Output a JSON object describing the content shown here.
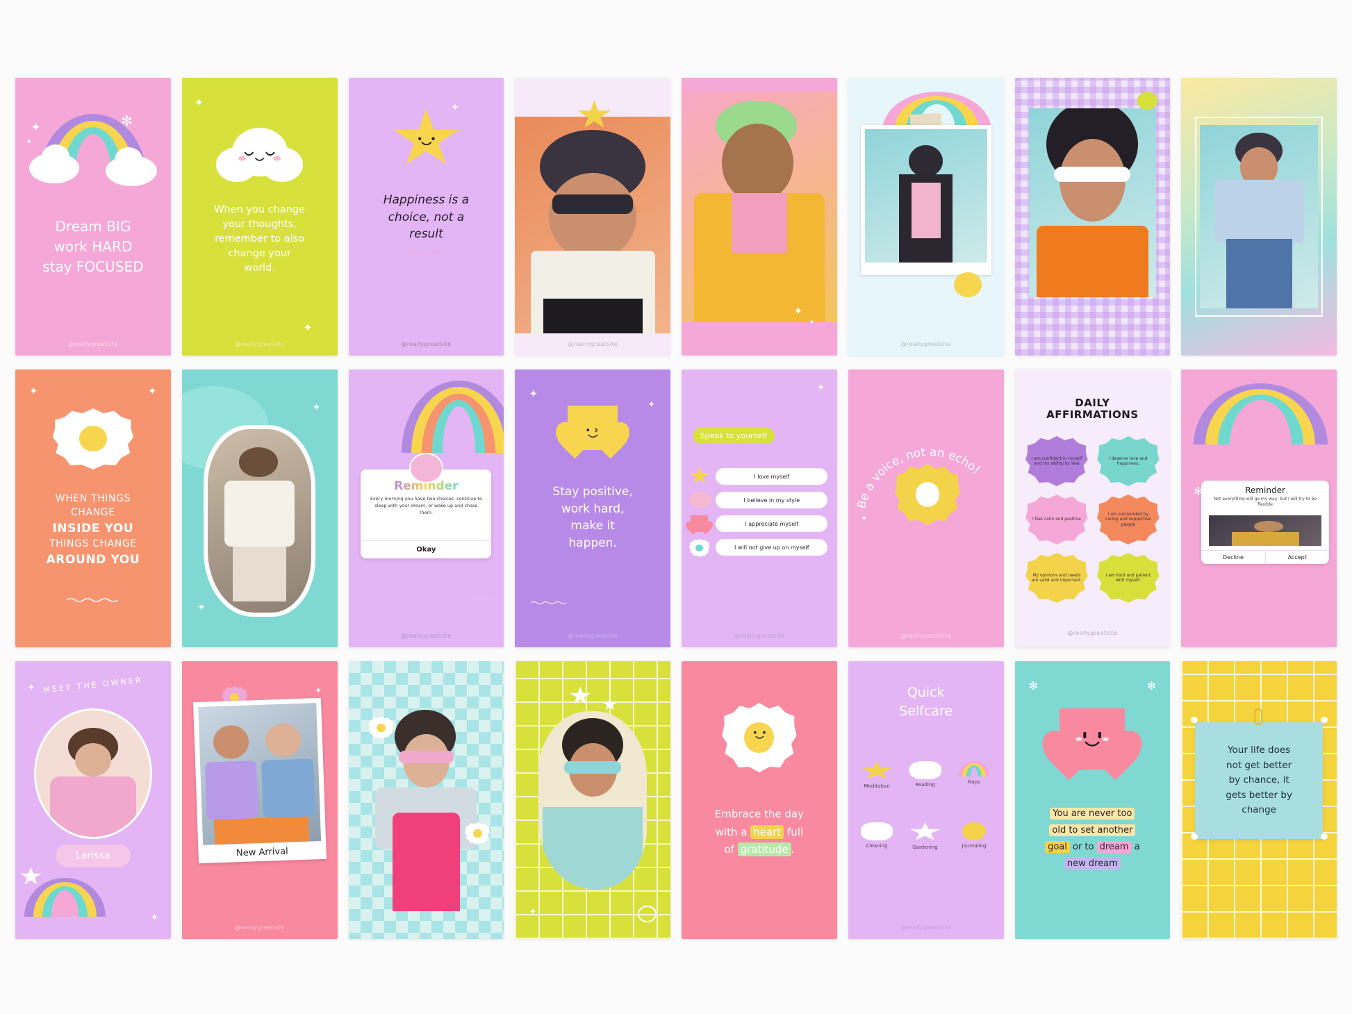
{
  "canvas": {
    "background": "#fbfbfb",
    "columns": 8,
    "rows": 3
  },
  "handle": "@reallygreatsite",
  "cards": [
    {
      "id": "dream-big",
      "row": 1,
      "col": 1,
      "type": "quote-rainbow",
      "background": "#f5a8d8",
      "text_color": "#ffffff",
      "quote_lines": [
        "Dream BIG",
        "work HARD",
        "stay FOCUSED"
      ],
      "handle": "@reallygreatsite",
      "motifs": [
        "rainbow",
        "clouds",
        "sparkles"
      ],
      "rainbow_colors": [
        "#b18ae0",
        "#f7d54f",
        "#6fd9cf"
      ]
    },
    {
      "id": "change-thoughts",
      "row": 1,
      "col": 2,
      "type": "quote-cloud",
      "background": "#d8e03c",
      "text_color": "#ffffff",
      "quote_lines": [
        "When you change",
        "your thoughts,",
        "remember to also",
        "change your",
        "world."
      ],
      "handle": "@reallygreatsite",
      "motifs": [
        "sleepy-cloud-face",
        "sparkles"
      ]
    },
    {
      "id": "happiness-choice",
      "row": 1,
      "col": 3,
      "type": "quote-star",
      "background": "#e4b5f5",
      "text_color": "#231d2b",
      "quote_lines": [
        "Happiness is a",
        "choice, not a",
        "result"
      ],
      "handle": "@reallygreatsite",
      "motifs": [
        "smiling-star",
        "underline-squiggle"
      ],
      "star_color": "#f7d54f"
    },
    {
      "id": "photo-sunglasses-cap",
      "row": 1,
      "col": 4,
      "type": "photo",
      "background": "#f6eaf9",
      "motifs": [
        "yellow-star-topper",
        "photo-portrait"
      ],
      "star_color": "#f2d34a"
    },
    {
      "id": "photo-braids-laughing",
      "row": 1,
      "col": 5,
      "type": "photo",
      "background": "#f5a8d8",
      "motifs": [
        "photo-portrait",
        "sparkles"
      ]
    },
    {
      "id": "polaroid-peace",
      "row": 1,
      "col": 6,
      "type": "photo-polaroid",
      "background": "#e7f6fb",
      "motifs": [
        "rainbow",
        "polaroid-frame",
        "tape",
        "smiling-sun"
      ],
      "rainbow_colors": [
        "#b18ae0",
        "#f7d54f",
        "#6fd9cf",
        "#f58fb8"
      ]
    },
    {
      "id": "gingham-cateye",
      "row": 1,
      "col": 7,
      "type": "photo-frame",
      "background": "#e7d6f7",
      "motifs": [
        "gingham-pattern",
        "photo-portrait",
        "flower-badge"
      ]
    },
    {
      "id": "gradient-denim",
      "row": 1,
      "col": 8,
      "type": "photo-frame",
      "background": "linear-gradient(160deg,#fbe9a2,#b9e8d2,#f3b9e0)",
      "motifs": [
        "white-border-frame",
        "photo-portrait"
      ]
    },
    {
      "id": "when-things-change",
      "row": 2,
      "col": 1,
      "type": "quote-daisy",
      "background": "#f79470",
      "text_color": "#ffffff",
      "quote_lines": [
        "WHEN THINGS",
        "CHANGE",
        "INSIDE YOU",
        "THINGS CHANGE",
        "AROUND YOU"
      ],
      "emphasis_lines": [
        "INSIDE YOU",
        "AROUND YOU"
      ],
      "motifs": [
        "smiling-daisy",
        "sparkles",
        "underline-squiggle"
      ]
    },
    {
      "id": "teal-friends-photo",
      "row": 2,
      "col": 2,
      "type": "photo-blob",
      "background": "#7fd9d2",
      "motifs": [
        "blob-frame",
        "photo-portrait",
        "sparkles"
      ]
    },
    {
      "id": "reminder-okay",
      "row": 2,
      "col": 3,
      "type": "popup-reminder",
      "background": "#e4b5f5",
      "title": "Reminder",
      "body": "Every morning you have two choices: continue to sleep with your dream, or wake up and chase them.",
      "button": "Okay",
      "handle": "@reallygreatsite",
      "motifs": [
        "rainbow",
        "avatar",
        "hearts"
      ],
      "title_colors": [
        "#f5a8d8",
        "#b18ae0",
        "#f7d54f",
        "#6fd9cf",
        "#f79470"
      ]
    },
    {
      "id": "stay-positive",
      "row": 2,
      "col": 4,
      "type": "quote-heart",
      "background": "#b88ae8",
      "text_color": "#ffffff",
      "quote_lines": [
        "Stay positive,",
        "work hard,",
        "make it",
        "happen."
      ],
      "handle": "@reallygreatsite",
      "motifs": [
        "winking-heart",
        "sparkles",
        "squiggle"
      ],
      "heart_color": "#f7d54f"
    },
    {
      "id": "speak-to-yourself",
      "row": 2,
      "col": 5,
      "type": "affirmation-list",
      "background": "#e4b5f5",
      "badge": "Speak to yourself",
      "badge_bg": "#d8e03c",
      "items": [
        {
          "icon": "star-icon",
          "text": "I love myself"
        },
        {
          "icon": "cloud-icon",
          "text": "I believe in my style"
        },
        {
          "icon": "heart-icon",
          "text": "I appreciate myself"
        },
        {
          "icon": "flower-icon",
          "text": "I will not give up on myself"
        }
      ],
      "handle": "@reallygreatsite"
    },
    {
      "id": "be-a-voice",
      "row": 2,
      "col": 6,
      "type": "quote-arc",
      "background": "#f5a8d8",
      "text_color": "#ffffff",
      "arc_text": "Be a voice, not an echo!",
      "handle": "@reallygreatsite",
      "motifs": [
        "yellow-flower",
        "sparkles"
      ],
      "flower_color": "#f2d34a"
    },
    {
      "id": "daily-affirmations",
      "row": 2,
      "col": 7,
      "type": "affirmation-grid",
      "background": "#f7ecfb",
      "title_lines": [
        "DAILY",
        "AFFIRMATIONS"
      ],
      "handle": "@reallygreatsite",
      "affirmations": [
        {
          "text": "I am confident in myself and my ability to heal",
          "color": "#b07ddb"
        },
        {
          "text": "I deserve love and happiness.",
          "color": "#79d6cd"
        },
        {
          "text": "I feel calm and positive",
          "color": "#f5a8d8"
        },
        {
          "text": "I am surrounded by caring and supportive people",
          "color": "#f4895e"
        },
        {
          "text": "My opinions and needs are valid and important.",
          "color": "#f2d34a"
        },
        {
          "text": "I am kind and patient with myself.",
          "color": "#d8e03c"
        }
      ]
    },
    {
      "id": "reminder-flexible",
      "row": 2,
      "col": 8,
      "type": "popup-dialog",
      "background": "#f5a8d8",
      "title": "Reminder",
      "body": "Not everything will go my way, but I will try to be flexible",
      "buttons": [
        "Decline",
        "Accept"
      ],
      "motifs": [
        "rainbow",
        "photo",
        "sparkle"
      ],
      "rainbow_colors": [
        "#b18ae0",
        "#f7d54f",
        "#6fd9cf",
        "#f5a8d8"
      ]
    },
    {
      "id": "meet-the-owner",
      "row": 3,
      "col": 1,
      "type": "profile-card",
      "background": "#e4b5f5",
      "heading": "MEET THE OWNER",
      "name": "Larissa",
      "name_bg": "#f5c6e8",
      "motifs": [
        "circle-photo",
        "rainbow",
        "star",
        "sparkles"
      ]
    },
    {
      "id": "new-arrival",
      "row": 3,
      "col": 2,
      "type": "polaroid-card",
      "background": "#f8899f",
      "caption": "New Arrival",
      "handle": "@reallygreatsite",
      "motifs": [
        "polaroid-frame",
        "flower",
        "sparkles"
      ]
    },
    {
      "id": "checkerboard-daisy",
      "row": 3,
      "col": 3,
      "type": "photo-checker",
      "background": "#a9e4e6",
      "motifs": [
        "checkerboard",
        "photo-portrait",
        "daisy-stickers"
      ]
    },
    {
      "id": "lime-grid-portrait",
      "row": 3,
      "col": 4,
      "type": "photo-grid",
      "background": "#d8e03c",
      "motifs": [
        "grid-lines",
        "blob-photo",
        "stars",
        "smiley"
      ]
    },
    {
      "id": "embrace-the-day",
      "row": 3,
      "col": 5,
      "type": "quote-highlight",
      "background": "#f8899f",
      "text_color": "#ffffff",
      "quote_parts": [
        {
          "text": "Embrace the day",
          "highlight": null
        },
        {
          "text": "with a ",
          "highlight": null
        },
        {
          "text": "heart",
          "highlight": "#f2d34a"
        },
        {
          "text": " full",
          "highlight": null
        },
        {
          "text": "of ",
          "highlight": null
        },
        {
          "text": "gratitude",
          "highlight": "#b9e8a8"
        },
        {
          "text": ".",
          "highlight": null
        }
      ],
      "motifs": [
        "smiling-daisy"
      ]
    },
    {
      "id": "quick-selfcare",
      "row": 3,
      "col": 6,
      "type": "icon-grid",
      "background": "#e4b5f5",
      "title_lines": [
        "Quick",
        "Selfcare"
      ],
      "title_color": "#ffffff",
      "handle": "@reallygreatsite",
      "items": [
        {
          "icon": "star-icon",
          "label": "Meditation",
          "color": "#f2d34a"
        },
        {
          "icon": "cloud-icon",
          "label": "Reading",
          "color": "#ffffff"
        },
        {
          "icon": "rainbow-icon",
          "label": "Naps",
          "color": "#6fd9cf"
        },
        {
          "icon": "cloud-icon",
          "label": "Cleaning",
          "color": "#ffffff"
        },
        {
          "icon": "star-icon",
          "label": "Gardening",
          "color": "#ffffff"
        },
        {
          "icon": "sun-icon",
          "label": "Journaling",
          "color": "#f2d34a"
        }
      ]
    },
    {
      "id": "never-too-old",
      "row": 3,
      "col": 7,
      "type": "quote-highlight-heart",
      "background": "#7fd9d2",
      "text_color": "#2c2230",
      "quote_lines": [
        [
          {
            "text": "You are never too",
            "highlight": "#fbe7a5"
          }
        ],
        [
          {
            "text": "old to set another",
            "highlight": "#fbe7a5"
          }
        ],
        [
          {
            "text": "goal",
            "highlight": "#f2d34a"
          },
          {
            "text": " or to ",
            "highlight": null
          },
          {
            "text": "dream",
            "highlight": "#f5a8d8"
          },
          {
            "text": " a",
            "highlight": null
          }
        ],
        [
          {
            "text": "new dream",
            "highlight": "#c7b3f0"
          }
        ]
      ],
      "motifs": [
        "smiling-heart",
        "sparkles"
      ],
      "heart_color": "#f8899f"
    },
    {
      "id": "life-does-not-get-better",
      "row": 3,
      "col": 8,
      "type": "sticky-note",
      "background": "#f5d33c",
      "note_bg": "#a8dee0",
      "text_color": "#20303a",
      "quote_lines": [
        "Your life does",
        "not get better",
        "by chance, it",
        "gets better by",
        "change"
      ],
      "motifs": [
        "grid-lines",
        "paperclip",
        "pin-dots"
      ]
    }
  ]
}
